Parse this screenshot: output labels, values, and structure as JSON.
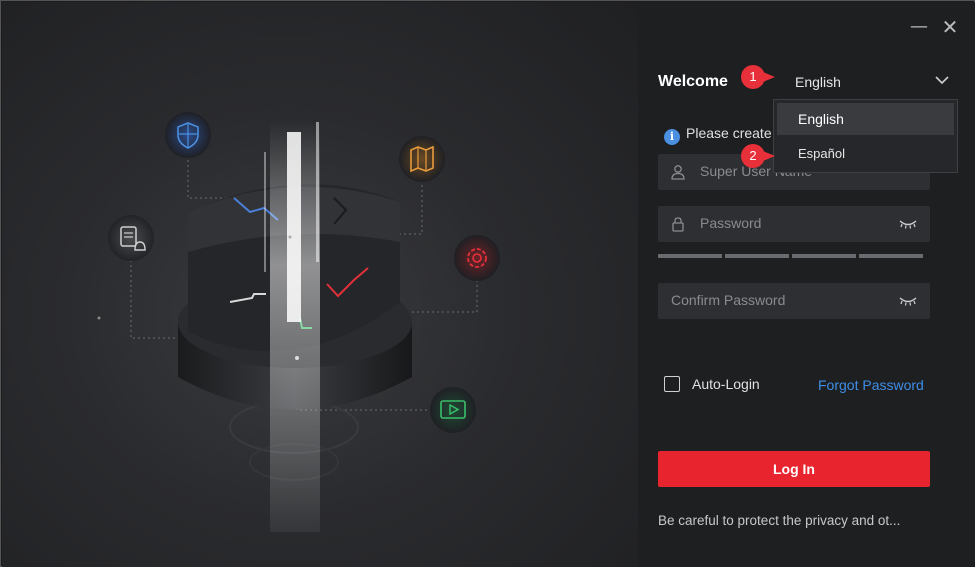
{
  "window": {
    "minimize_glyph": "—",
    "close_glyph": "✕"
  },
  "header": {
    "welcome": "Welcome",
    "language_selected": "English"
  },
  "language_menu": {
    "options": [
      "English",
      "Español"
    ]
  },
  "info": {
    "text": "Please create"
  },
  "form": {
    "username_placeholder": "Super User Name",
    "password_placeholder": "Password",
    "confirm_placeholder": "Confirm Password",
    "auto_login_label": "Auto-Login",
    "forgot_password": "Forgot Password",
    "login_button": "Log In",
    "privacy_notice": "Be careful to protect the privacy and ot..."
  },
  "callouts": [
    "1",
    "2"
  ],
  "icons": [
    "shield-icon",
    "map-icon",
    "document-alarm-icon",
    "settings-icon",
    "video-icon",
    "user-icon",
    "lock-icon",
    "eye-hidden-icon",
    "chevron-down-icon",
    "info-icon"
  ],
  "colors": {
    "accent_red": "#e8242f",
    "link_blue": "#3e8ee8",
    "background": "#1e1f21"
  }
}
